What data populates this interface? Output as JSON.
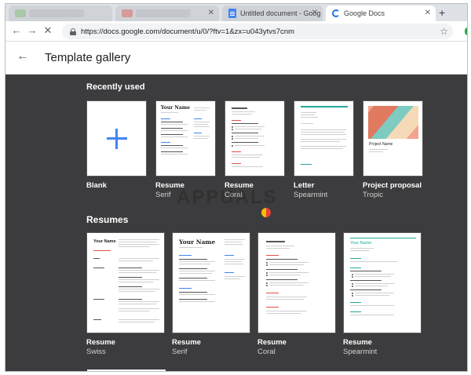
{
  "browser": {
    "tabs": [
      {
        "label": "",
        "active": false,
        "blurred": true
      },
      {
        "label": "",
        "active": false,
        "blurred": true
      },
      {
        "label": "Untitled document - Goog",
        "active": false,
        "icon": "docs-icon"
      },
      {
        "label": "Google Docs",
        "active": true,
        "icon": "loading-spinner-icon"
      }
    ],
    "new_tab_label": "+",
    "url": "https://docs.google.com/document/u/0/?ftv=1&zx=u043ytvs7cnm"
  },
  "header": {
    "back_label": "←",
    "title": "Template gallery"
  },
  "sections": [
    {
      "title": "Recently used",
      "templates": [
        {
          "name": "Blank",
          "subtitle": ""
        },
        {
          "name": "Resume",
          "subtitle": "Serif"
        },
        {
          "name": "Resume",
          "subtitle": "Coral"
        },
        {
          "name": "Letter",
          "subtitle": "Spearmint"
        },
        {
          "name": "Project proposal",
          "subtitle": "Tropic"
        }
      ]
    },
    {
      "title": "Resumes",
      "templates": [
        {
          "name": "Resume",
          "subtitle": "Swiss"
        },
        {
          "name": "Resume",
          "subtitle": "Serif"
        },
        {
          "name": "Resume",
          "subtitle": "Coral"
        },
        {
          "name": "Resume",
          "subtitle": "Spearmint"
        }
      ]
    }
  ],
  "thumbnails": {
    "serif_name": "Your Name",
    "swiss_name": "Your Name",
    "spearmint_name": "Your Name",
    "proposal_title": "Project Name"
  },
  "watermark": "APPUALS",
  "colors": {
    "gallery_bg": "#3c3c3e",
    "accent_blue": "#4285f4",
    "swiss_red": "#e15241",
    "spearmint_green": "#26a69a"
  }
}
